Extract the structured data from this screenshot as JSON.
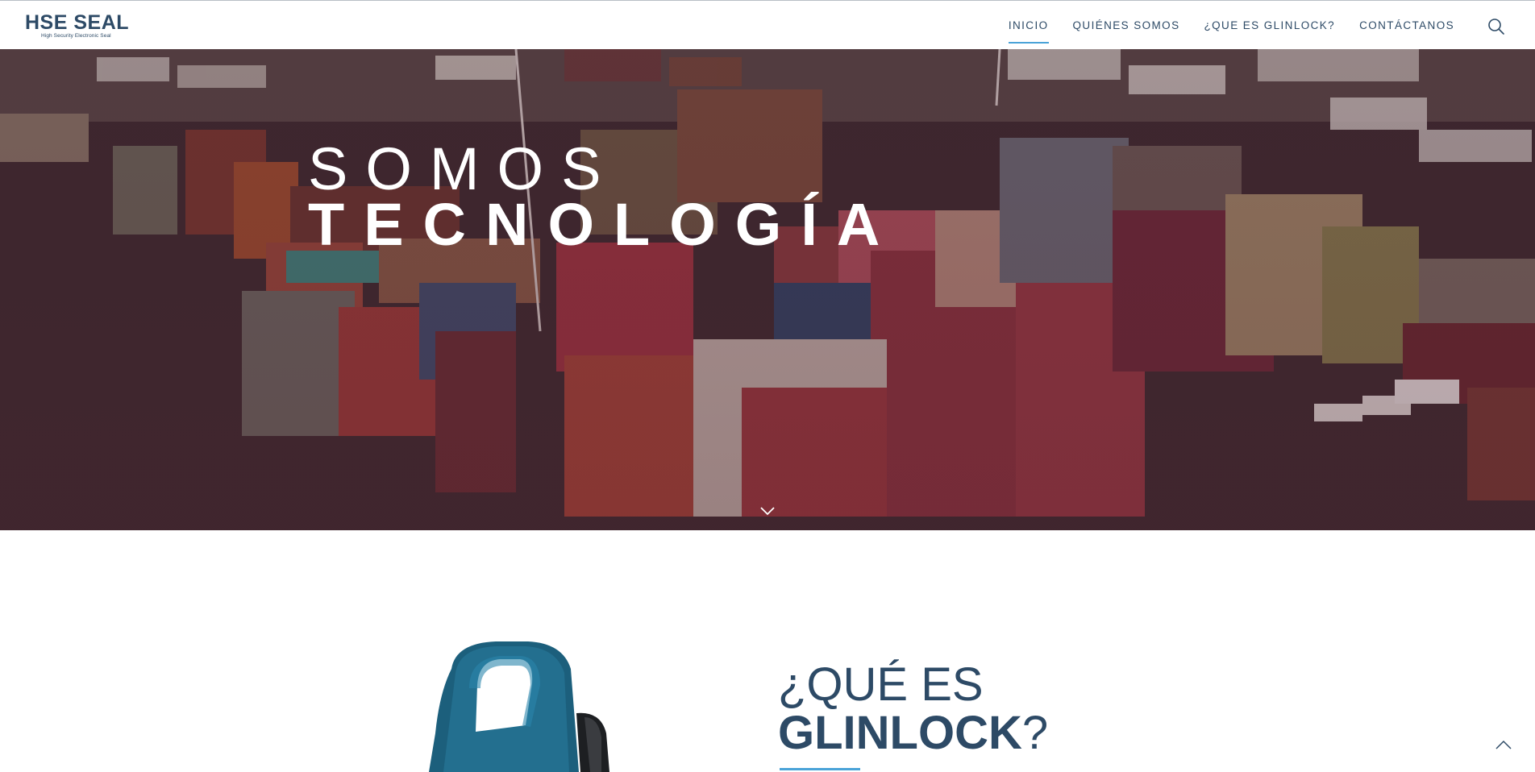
{
  "brand": {
    "name": "HSE SEAL",
    "tagline": "High Security Electronic Seal"
  },
  "nav": {
    "items": [
      {
        "label": "INICIO",
        "active": true
      },
      {
        "label": "QUIÉNES SOMOS",
        "active": false
      },
      {
        "label": "¿QUE ES GLINLOCK?",
        "active": false
      },
      {
        "label": "CONTÁCTANOS",
        "active": false
      }
    ],
    "search_icon": "search-icon"
  },
  "hero": {
    "line1": "SOMOS",
    "line2": "TECNOLOGÍA",
    "scroll_icon": "chevron-down-icon"
  },
  "section": {
    "title_prefix": "¿QUÉ ES",
    "title_brand": "GLINLOCK",
    "title_suffix": "?"
  },
  "colors": {
    "brand": "#2d4a66",
    "accent": "#4aa3d8"
  },
  "back_to_top_icon": "chevron-up-icon"
}
